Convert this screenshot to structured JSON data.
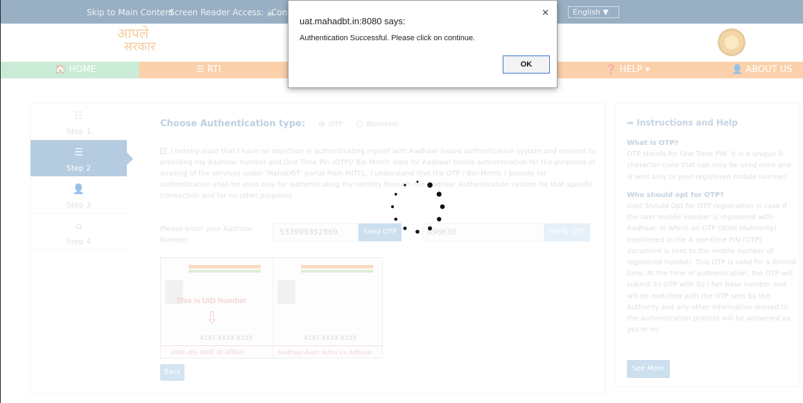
{
  "topbar": {
    "skip": "Skip to Main Content",
    "screen_reader": "Screen Reader Access: 🔈",
    "contrast": "Cont",
    "language": "English ▼"
  },
  "brand": {
    "line1": "आपले",
    "line2": "सरकार"
  },
  "nav": {
    "home": "🏠 HOME",
    "rti": "☰ RTI",
    "help": "❓ HELP ▾",
    "about": "👤 ABOUT US"
  },
  "steps": [
    {
      "label": "Step 1",
      "icon": "☷"
    },
    {
      "label": "Step 2",
      "icon": "☰"
    },
    {
      "label": "Step 3",
      "icon": "👤"
    },
    {
      "label": "Step 4",
      "icon": "⌂"
    }
  ],
  "auth": {
    "heading": "Choose Authentication type:",
    "opt_otp": "OTP",
    "opt_bio": "Biometric",
    "consent": "I hereby state that I have no objection in authenticating myself with Aadhaar based authentication system and consent to providing my Aadhaar number and One Time Pin (OTP)/ Bio Metric data for Aadhaar based authentication for the purposes of availing of the services under 'MahaDBT' portal from MITCL. I understand that the OTP / Bio-Metric I provide for authentication shall be used only for authenticating my identity through the Aadhaar Authentication system for that specific transaction and for no other purposes."
  },
  "form": {
    "aadhaar_label": "Please enter your Aadhaar Number",
    "aadhaar_value": "533999352869",
    "send_otp": "Send OTP",
    "otp_value": "896638",
    "verify_otp": "Verify OTP",
    "back": "Back"
  },
  "card": {
    "uid_label": "This is UID Number",
    "number_a": "4197 XXXX 6155",
    "number_b": "4197 XXXX 6155",
    "footer_hi": "आधार-आम आदमी का अधिकार",
    "footer_en": "Aadhaar-Aam Admi ka Adhikar"
  },
  "help": {
    "title": "Instructions and Help",
    "q1": "What is OTP?",
    "a1": "OTP stands for One Time PIN. It is a unique 6-character code that can only be used once and is sent only to your registered mobile number.",
    "q2": "Who should opt for OTP?",
    "a2": "User Should Opt for OTP registration in case if the user mobile number is registered with Aadhaar. In which an OTP UIDAI (Authority) mentioned in the A one-time PIN (OTP) document is sent to the mobile number of registered number. This OTP is valid for a limited time. At the time of authentication, the OTP will submit its OTP with its / her base number and will be matched with the OTP sent by the Authority and any other information related to the authentication process will be answered as yes or no",
    "see_more": "See More"
  },
  "alert": {
    "title": "uat.mahadbt.in:8080 says:",
    "message": "Authentication Successful. Please click on continue.",
    "ok": "OK",
    "close": "×"
  },
  "icons": {
    "spinner": "loading-spinner-icon",
    "arrow": "share-arrow-icon"
  }
}
